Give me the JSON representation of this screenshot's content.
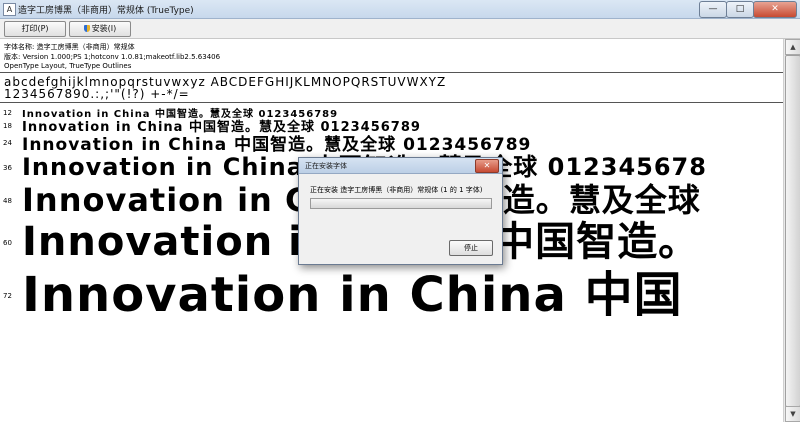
{
  "window": {
    "title": "造字工房博黑（非商用）常规体 (TrueType)",
    "minimize": "—",
    "maximize": "□",
    "close": "✕"
  },
  "toolbar": {
    "print_label": "打印(P)",
    "install_label": "安装(I)"
  },
  "font_info": {
    "name_line": "字体名称: 造字工房博黑（非商用）常规体",
    "version_line": "版本: Version 1.000;PS 1;hotconv 1.0.81;makeotf.lib2.5.63406",
    "outline_line": "OpenType Layout, TrueType Outlines"
  },
  "charset": {
    "line1": "abcdefghijklmnopqrstuvwxyz ABCDEFGHIJKLMNOPQRSTUVWXYZ",
    "line2": "1234567890.:,;'\"(!?) +-*/="
  },
  "samples": [
    {
      "size": "12",
      "text": "Innovation in China 中国智造。慧及全球 0123456789"
    },
    {
      "size": "18",
      "text": "Innovation in China 中国智造。慧及全球 0123456789"
    },
    {
      "size": "24",
      "text": "Innovation in China 中国智造。慧及全球 0123456789"
    },
    {
      "size": "36",
      "text": "Innovation in China 中国智造。慧及全球 012345678"
    },
    {
      "size": "48",
      "text": "Innovation in China 中国智造。慧及全球"
    },
    {
      "size": "60",
      "text": "Innovation in China 中国智造。"
    },
    {
      "size": "72",
      "text": "Innovation in China 中国"
    }
  ],
  "dialog": {
    "title": "正在安装字体",
    "close": "✕",
    "message": "正在安装 造字工房博黑（非商用）常规体 (1 的 1 字体)",
    "progress": 0,
    "stop_label": "停止"
  },
  "scrollbar": {
    "up": "▲",
    "down": "▼"
  }
}
